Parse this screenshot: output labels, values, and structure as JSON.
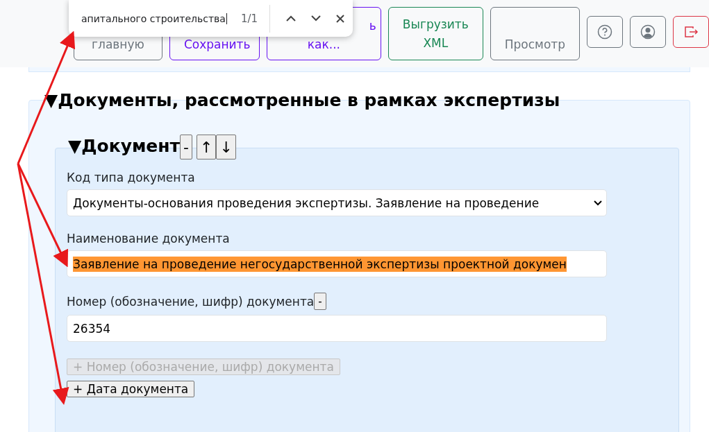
{
  "toolbar": {
    "buttons": [
      {
        "lines": [
          "главную"
        ],
        "color": "#6c757d",
        "first_line_cut": false
      },
      {
        "lines": [
          "Сохранить"
        ],
        "color": "#6610f2",
        "first_line_cut": false
      },
      {
        "lines": [
          "ь",
          "как..."
        ],
        "color": "#6610f2",
        "first_line_cut": true
      },
      {
        "lines": [
          "Выгрузить",
          "XML"
        ],
        "color": "#198754",
        "first_line_cut": false
      },
      {
        "lines": [
          "Просмотр"
        ],
        "color": "#6c757d",
        "first_line_cut": false
      }
    ],
    "icons": [
      {
        "kind": "help",
        "color": "#6c757d"
      },
      {
        "kind": "user",
        "color": "#6c757d"
      },
      {
        "kind": "logout",
        "color": "#dc3545"
      }
    ]
  },
  "find_bar": {
    "query": "апитального строительства",
    "count": "1/1"
  },
  "section": {
    "title": "▼Документы, рассмотренные в рамках экспертизы",
    "document": {
      "title": "▼Документ",
      "buttons": [
        "-",
        "↑",
        "↓"
      ],
      "fields": [
        {
          "kind": "select",
          "label": "Код типа документа",
          "value": "Документы-основания проведения экспертизы. Заявление на проведение"
        },
        {
          "kind": "text",
          "label": "Наименование документа",
          "value": "Заявление на проведение негосударственной экспертизы проектной докумен",
          "highlighted": true
        },
        {
          "kind": "text",
          "label": "Номер (обозначение, шифр) документа",
          "label_button": "-",
          "value": "26354",
          "highlighted": false
        }
      ],
      "add_buttons": [
        {
          "label": "+ Номер (обозначение, шифр) документа",
          "disabled": true
        },
        {
          "label": "+ Дата документа",
          "disabled": false
        }
      ]
    }
  }
}
